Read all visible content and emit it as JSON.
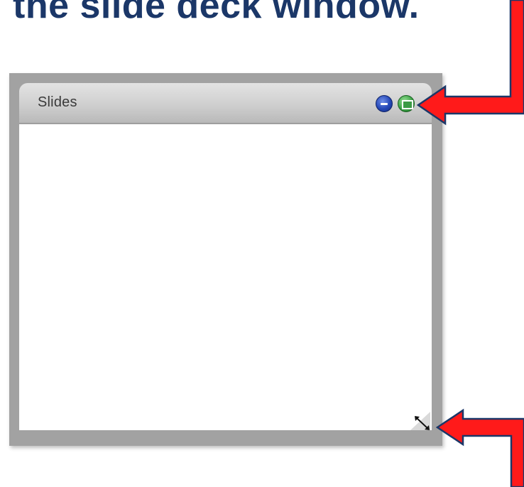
{
  "heading": {
    "text": "the slide deck window."
  },
  "window": {
    "title": "Slides",
    "minimize_icon": "minimize-icon",
    "maximize_icon": "maximize-icon",
    "resize_icon": "resize-diagonal-icon"
  },
  "colors": {
    "heading": "#1b3768",
    "frame": "#a2a2a2",
    "arrow_fill": "#ff1a1a",
    "arrow_border": "#1b3768",
    "minimize_button": "#2447b6",
    "maximize_button": "#3da447"
  }
}
